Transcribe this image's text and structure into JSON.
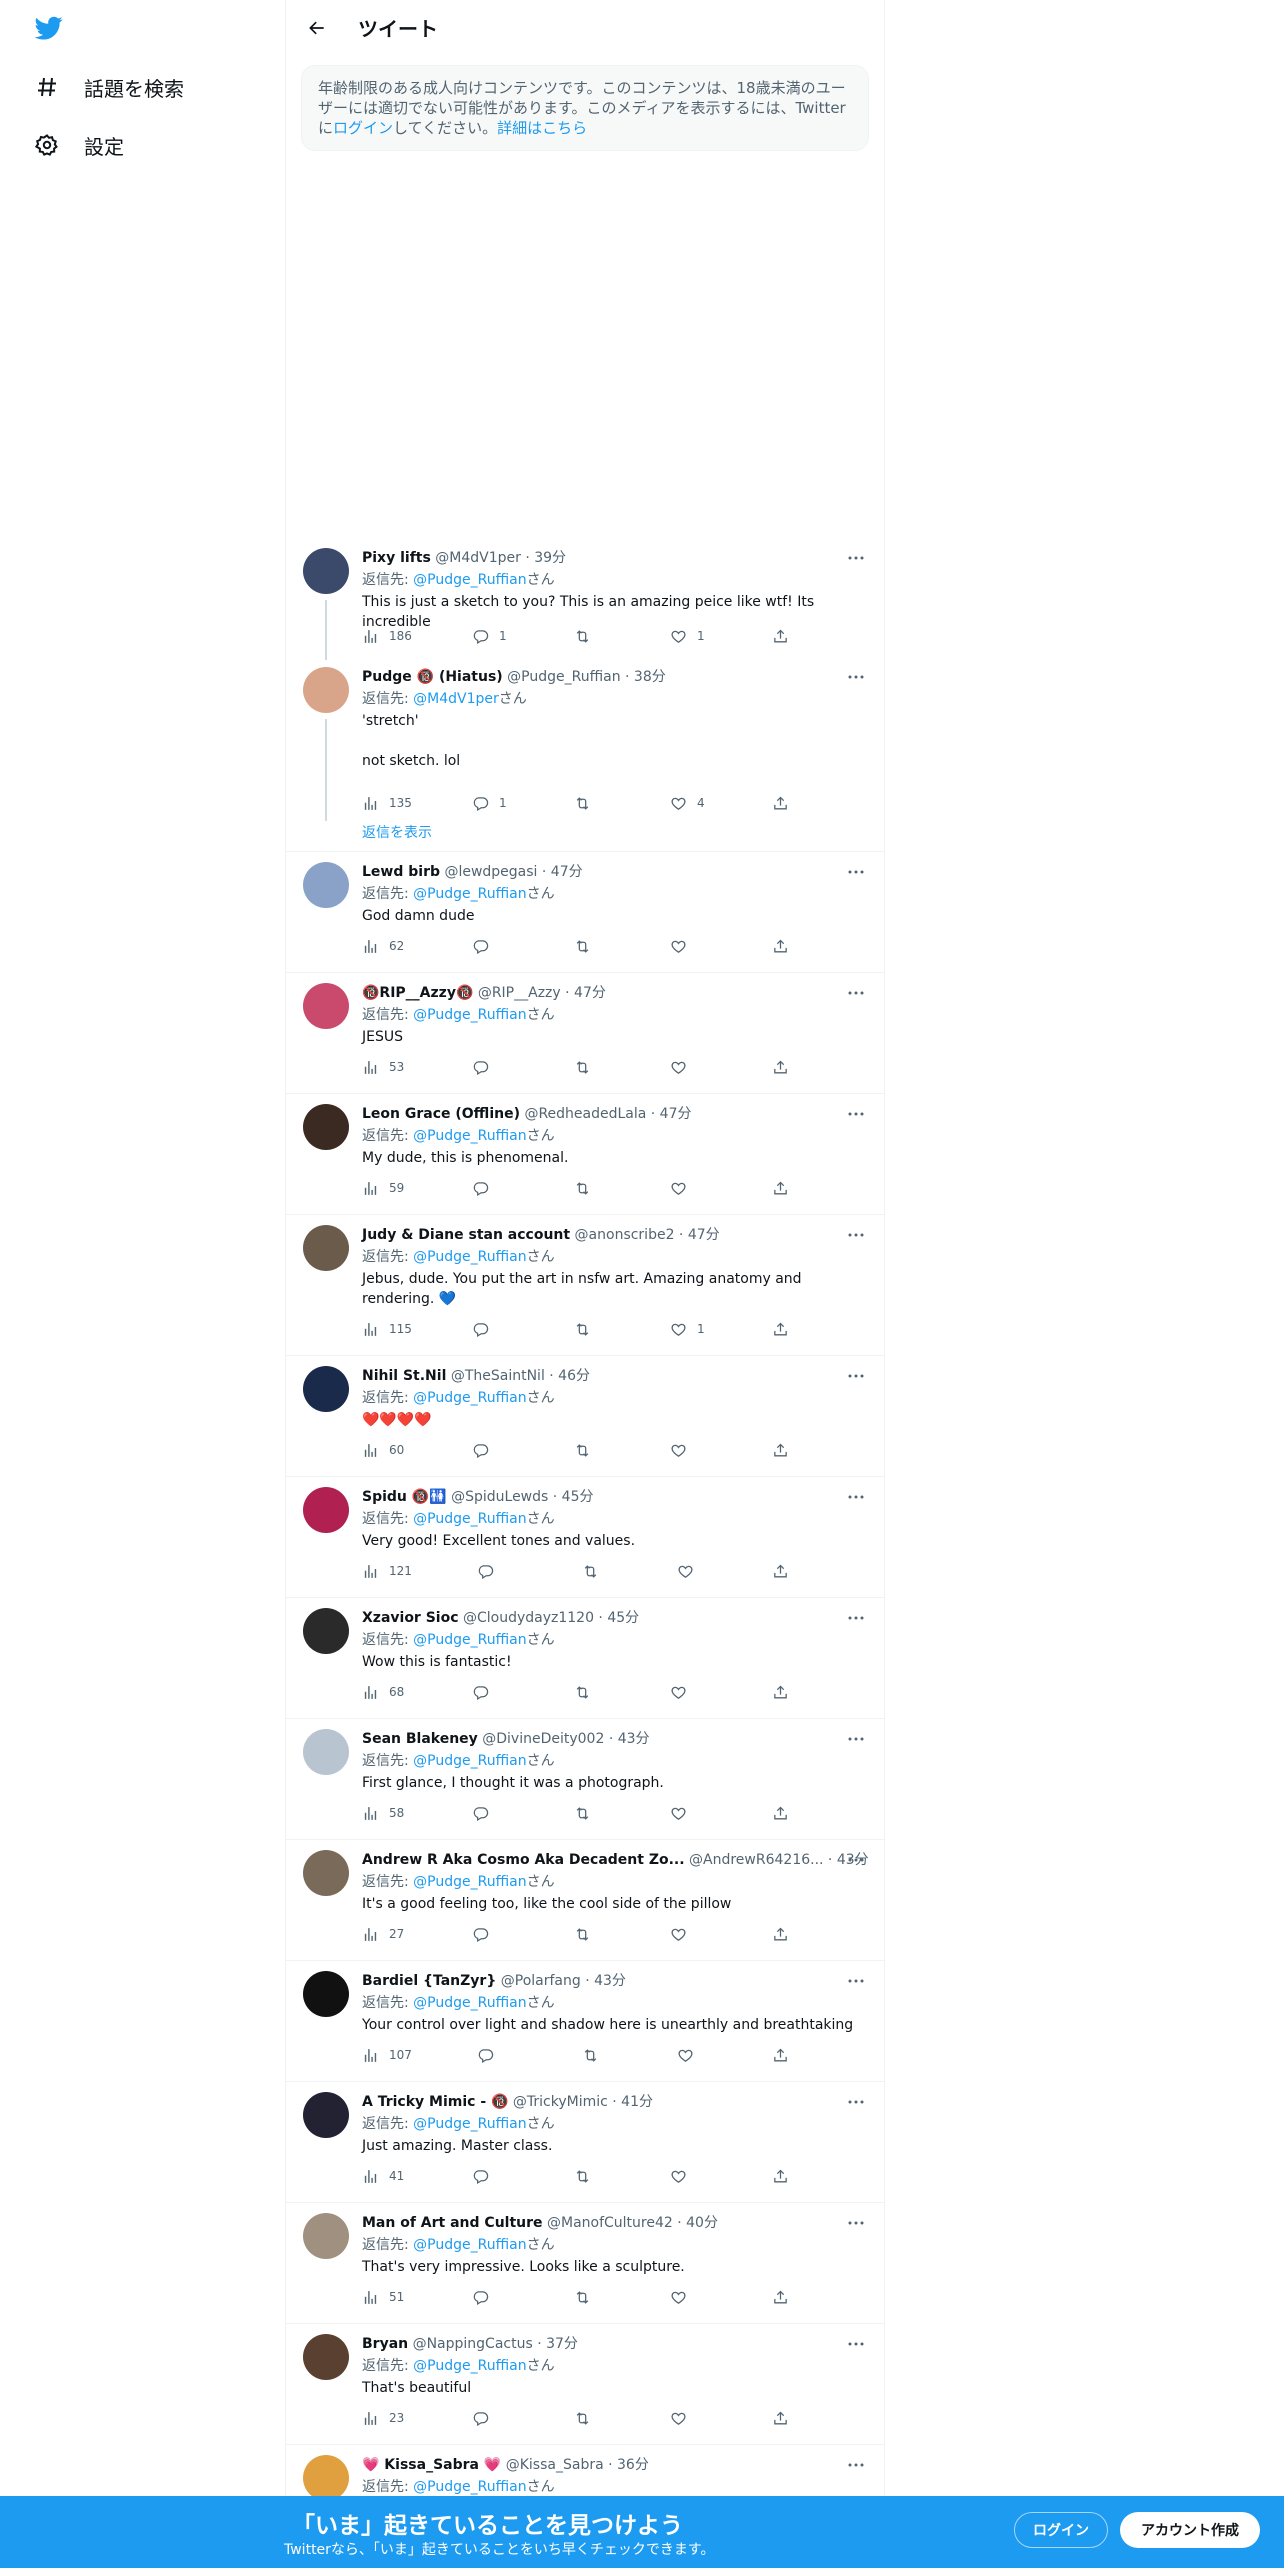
{
  "sidebar": {
    "logo": "twitter-bird-icon",
    "items": [
      {
        "label": "話題を検索",
        "icon": "hashtag-icon"
      },
      {
        "label": "設定",
        "icon": "gear-icon"
      }
    ]
  },
  "header": {
    "title": "ツイート"
  },
  "notice": {
    "text_1": "年齢制限のある成人向けコンテンツです。このコンテンツは、18歳未満のユーザーには適切でない可能性があります。このメディアを表示するには、Twitter",
    "text_2": "に",
    "login_link": "ログイン",
    "text_3": "してください。",
    "details_link": "詳細はこちら"
  },
  "reply_prefix": "返信先: ",
  "reply_suffix": "さん",
  "show_replies": "返信を表示",
  "tweets": [
    {
      "name": "Pixy lifts",
      "handle": "@M4dV1per · 39分",
      "reply_to": "@Pudge_Ruffian",
      "text": "This is just a sketch to you? This is an amazing peice like wtf! Its incredible",
      "views": "186",
      "replies": "1",
      "retweets": "",
      "likes": "1"
    },
    {
      "name": "Pudge 🔞 (Hiatus)",
      "handle": "@Pudge_Ruffian · 38分",
      "reply_to": "@M4dV1per",
      "text_1": "'stretch'",
      "text_2": "not sketch. lol",
      "views": "135",
      "replies": "1",
      "retweets": "",
      "likes": "4"
    },
    {
      "name": "Lewd birb",
      "handle": "@lewdpegasi · 47分",
      "reply_to": "@Pudge_Ruffian",
      "text": "God damn dude",
      "views": "62",
      "replies": "",
      "retweets": "",
      "likes": ""
    },
    {
      "name": "🔞RIP__Azzy🔞",
      "handle": "@RIP__Azzy · 47分",
      "reply_to": "@Pudge_Ruffian",
      "text": "JESUS",
      "views": "53",
      "replies": "",
      "retweets": "",
      "likes": ""
    },
    {
      "name": "Leon Grace (Offline)",
      "handle": "@RedheadedLala · 47分",
      "reply_to": "@Pudge_Ruffian",
      "text": "My dude, this is phenomenal.",
      "views": "59",
      "replies": "",
      "retweets": "",
      "likes": ""
    },
    {
      "name": "Judy & Diane stan account",
      "handle": "@anonscribe2 · 47分",
      "reply_to": "@Pudge_Ruffian",
      "text": "Jebus, dude. You put the art in nsfw art. Amazing anatomy and rendering. 💙",
      "views": "115",
      "replies": "",
      "retweets": "",
      "likes": "1"
    },
    {
      "name": "Nihil St.Nil",
      "handle": "@TheSaintNil · 46分",
      "reply_to": "@Pudge_Ruffian",
      "text": "❤️❤️❤️❤️",
      "views": "60",
      "replies": "",
      "retweets": "",
      "likes": ""
    },
    {
      "name": "Spidu 🔞🚻",
      "handle": "@SpiduLewds · 45分",
      "reply_to": "@Pudge_Ruffian",
      "text": "Very good! Excellent tones and values.",
      "views": "121",
      "replies": "",
      "retweets": "",
      "likes": ""
    },
    {
      "name": "Xzavior Sioc",
      "handle": "@Cloudydayz1120 · 45分",
      "reply_to": "@Pudge_Ruffian",
      "text": "Wow this is fantastic!",
      "views": "68",
      "replies": "",
      "retweets": "",
      "likes": ""
    },
    {
      "name": "Sean Blakeney",
      "handle": "@DivineDeity002 · 43分",
      "reply_to": "@Pudge_Ruffian",
      "text": "First glance, I thought it was a photograph.",
      "views": "58",
      "replies": "",
      "retweets": "",
      "likes": ""
    },
    {
      "name": "Andrew R Aka Cosmo Aka Decadent Zo...",
      "handle": "@AndrewR64216... · 43分",
      "reply_to": "@Pudge_Ruffian",
      "text": "It's a good feeling too, like the cool side of the pillow",
      "views": "27",
      "replies": "",
      "retweets": "",
      "likes": ""
    },
    {
      "name": "Bardiel {TanZyr}",
      "handle": "@Polarfang · 43分",
      "reply_to": "@Pudge_Ruffian",
      "text": "Your control over light and shadow here is unearthly and breathtaking",
      "views": "107",
      "replies": "",
      "retweets": "",
      "likes": ""
    },
    {
      "name": "A Tricky Mimic - 🔞",
      "handle": "@TrickyMimic · 41分",
      "reply_to": "@Pudge_Ruffian",
      "text": "Just amazing. Master class.",
      "views": "41",
      "replies": "",
      "retweets": "",
      "likes": ""
    },
    {
      "name": "Man of Art and Culture",
      "handle": "@ManofCulture42 · 40分",
      "reply_to": "@Pudge_Ruffian",
      "text": "That's very impressive. Looks like a sculpture.",
      "views": "51",
      "replies": "",
      "retweets": "",
      "likes": ""
    },
    {
      "name": "Bryan",
      "handle": "@NappingCactus · 37分",
      "reply_to": "@Pudge_Ruffian",
      "text": "That's beautiful",
      "views": "23",
      "replies": "",
      "retweets": "",
      "likes": ""
    },
    {
      "name": "💗 Kissa_Sabra 💗",
      "handle": "@Kissa_Sabra · 36分",
      "reply_to": "@Pudge_Ruffian",
      "text": "",
      "views": "",
      "replies": "",
      "retweets": "",
      "likes": ""
    }
  ],
  "banner": {
    "title": "「いま」起きていることを見つけよう",
    "subtitle": "Twitterなら、「いま」起きていることをいち早くチェックできます。",
    "login": "ログイン",
    "signup": "アカウント作成"
  },
  "colors": {
    "accent": "#1d9bf0",
    "muted": "#536471",
    "text": "#0f1419",
    "border": "#eff3f4"
  }
}
